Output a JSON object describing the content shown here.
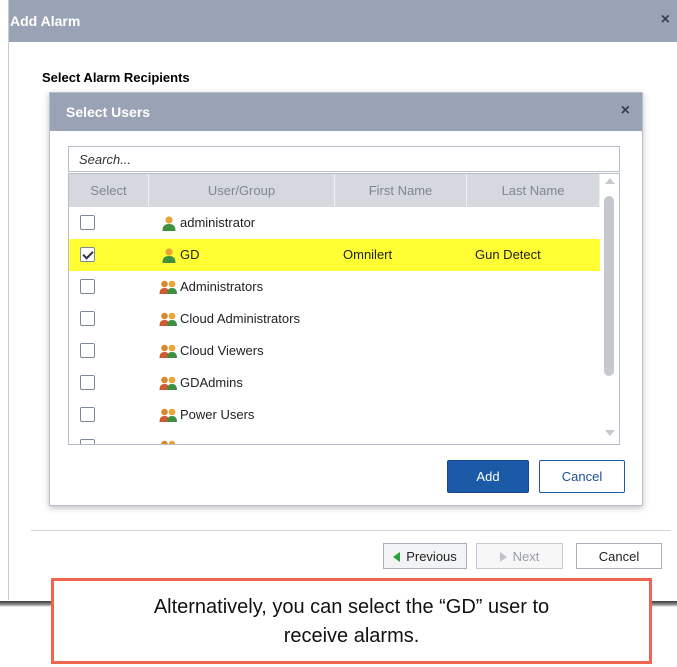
{
  "outer_dialog": {
    "title": "Add Alarm",
    "close": "×",
    "section_label": "Select Alarm Recipients"
  },
  "inner_dialog": {
    "title": "Select Users",
    "close": "×",
    "search_placeholder": "Search...",
    "columns": [
      "Select",
      "User/Group",
      "First Name",
      "Last Name"
    ],
    "rows": [
      {
        "type": "user",
        "name": "administrator",
        "first": "",
        "last": "",
        "checked": false
      },
      {
        "type": "user",
        "name": "GD",
        "first": "Omnilert",
        "last": "Gun Detect",
        "checked": true
      },
      {
        "type": "group",
        "name": "Administrators",
        "first": "",
        "last": "",
        "checked": false
      },
      {
        "type": "group",
        "name": "Cloud Administrators",
        "first": "",
        "last": "",
        "checked": false
      },
      {
        "type": "group",
        "name": "Cloud Viewers",
        "first": "",
        "last": "",
        "checked": false
      },
      {
        "type": "group",
        "name": "GDAdmins",
        "first": "",
        "last": "",
        "checked": false
      },
      {
        "type": "group",
        "name": "Power Users",
        "first": "",
        "last": "",
        "checked": false
      },
      {
        "type": "group",
        "name": "",
        "first": "",
        "last": "",
        "checked": false
      }
    ],
    "add_label": "Add",
    "cancel_label": "Cancel"
  },
  "footer": {
    "previous_label": "Previous",
    "next_label": "Next",
    "cancel_label": "Cancel"
  },
  "callout": {
    "line1": "Alternatively, you can select the “GD” user to",
    "line2": "receive alarms."
  },
  "colors": {
    "title_bar": "#9aa3b6",
    "highlight": "#ffff33",
    "primary": "#1a5aa6",
    "callout_border": "#f0654f"
  }
}
